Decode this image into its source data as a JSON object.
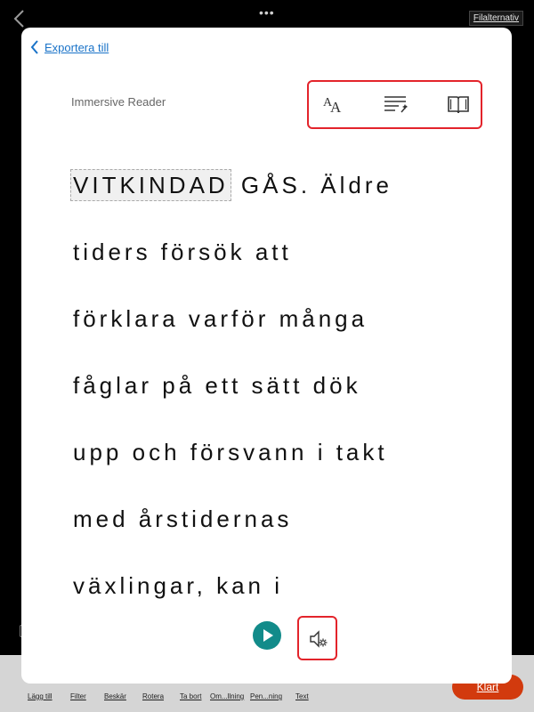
{
  "app": {
    "file_options_label": "Filalternativ",
    "done_label": "Klart",
    "toolbar_items": [
      {
        "label": "Lägg till",
        "icon": "add-icon"
      },
      {
        "label": "Filter",
        "icon": "filter-icon"
      },
      {
        "label": "Beskär",
        "icon": "crop-icon"
      },
      {
        "label": "Rotera",
        "icon": "rotate-icon"
      },
      {
        "label": "Ta bort",
        "icon": "delete-icon"
      },
      {
        "label": "Om...llning",
        "icon": "reorder-icon"
      },
      {
        "label": "Pen...ning",
        "icon": "pen-icon"
      },
      {
        "label": "Text",
        "icon": "text-icon"
      }
    ]
  },
  "reader": {
    "back_label": "Exportera till",
    "title": "Immersive Reader",
    "tools": [
      {
        "name": "text-size-icon"
      },
      {
        "name": "text-preferences-icon"
      },
      {
        "name": "reading-preferences-icon"
      }
    ],
    "highlighted_word": "VITKINDAD",
    "first_line_rest": " GÅS. Äldre",
    "lines": [
      "tiders försök att",
      "förklara varför många",
      "fåglar på ett sätt dök",
      "upp och försvann i takt",
      "med årstidernas",
      "växlingar, kan i"
    ],
    "accent_color": "#128b8a",
    "link_color": "#1a73c8",
    "highlight_box_color": "#e3242b"
  }
}
